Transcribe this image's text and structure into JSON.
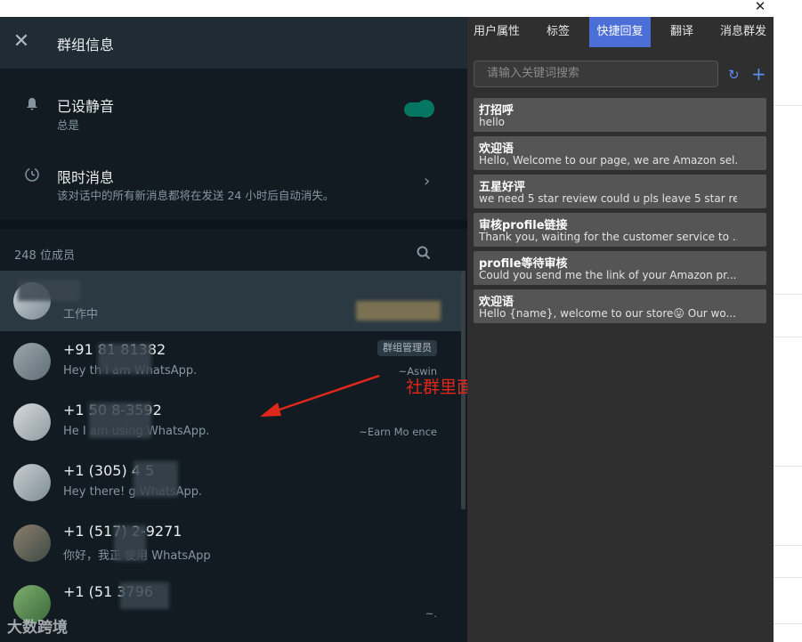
{
  "window": {
    "close_glyph": "✕"
  },
  "group_info": {
    "title": "群组信息",
    "close_icon": "close-icon",
    "mute": {
      "title": "已设静音",
      "subtitle": "总是",
      "enabled": true
    },
    "disappearing": {
      "title": "限时消息",
      "subtitle": "该对话中的所有新消息都将在发送 24 小时后自动消失。"
    },
    "members_count": "248 位成员",
    "members": [
      {
        "name": "",
        "status": "工作中",
        "alias": "",
        "badge": ""
      },
      {
        "name": "+91 81      81382",
        "status": "Hey th      I am       WhatsApp.",
        "alias": "~Aswin",
        "badge": "群组管理员"
      },
      {
        "name": "+1      50     8-3592",
        "status": "He           I am using WhatsApp.",
        "alias": "~Earn Mo         ence",
        "badge": ""
      },
      {
        "name": "+1 (305) 4     5",
        "status": "Hey there!      g WhatsApp.",
        "alias": "",
        "badge": ""
      },
      {
        "name": "+1 (517)      2-9271",
        "status": "你好，我正      使用 WhatsApp",
        "alias": "",
        "badge": ""
      },
      {
        "name": "+1 (51          3796",
        "status": "",
        "alias": "~.",
        "badge": ""
      }
    ]
  },
  "annotation": {
    "text": "社群里面的用户信息全部可见",
    "color": "#e0271b"
  },
  "watermark": "大数跨境",
  "quick_reply_panel": {
    "tabs": [
      "用户属性",
      "标签",
      "快捷回复",
      "翻译",
      "消息群发"
    ],
    "active_tab": "快捷回复",
    "search_placeholder": "请输入关键词搜索",
    "items": [
      {
        "title": "打招呼",
        "body": "hello"
      },
      {
        "title": "欢迎语",
        "body": "Hello, Welcome to our page, we are Amazon sel..."
      },
      {
        "title": "五星好评",
        "body": "we need 5 star review could u pls leave 5 star re..."
      },
      {
        "title": "审核profile链接",
        "body": "Thank you, waiting for the customer service to ..."
      },
      {
        "title": "profile等待审核",
        "body": "Could you send me the link of your Amazon pr..."
      },
      {
        "title": "欢迎语",
        "body": "Hello {name}, welcome to our store😛 Our wo..."
      }
    ]
  },
  "colors": {
    "accent_green": "#00a884",
    "tab_active": "#4b6fd6",
    "panel_dark": "#111b21"
  }
}
